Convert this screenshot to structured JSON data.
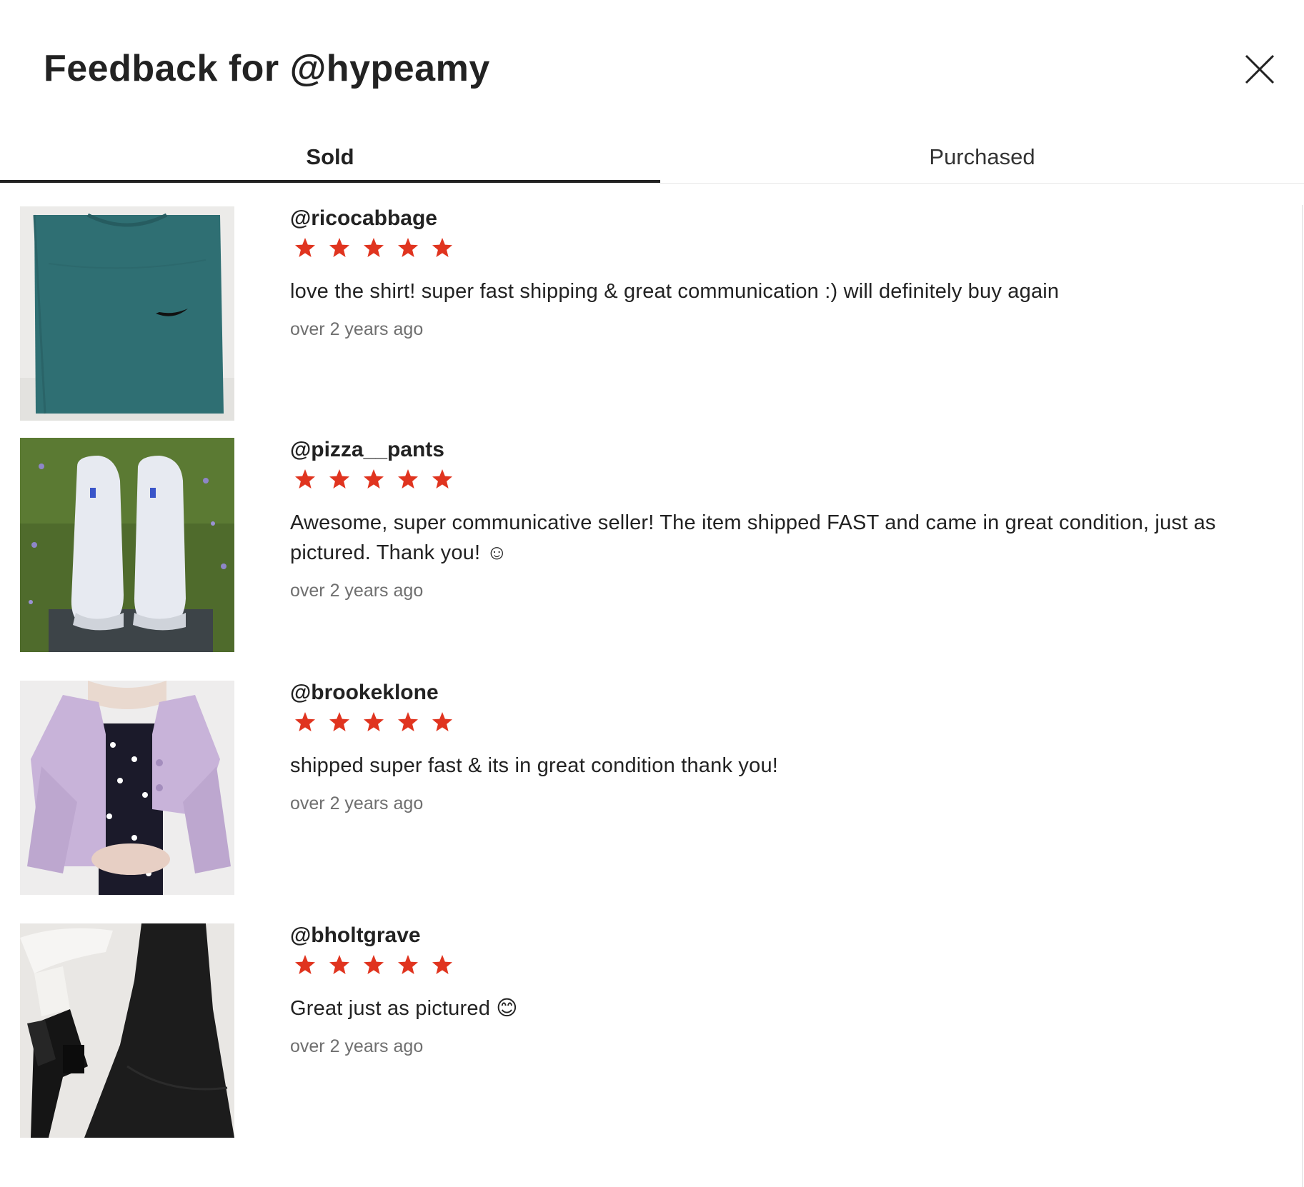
{
  "modal": {
    "title": "Feedback for @hypeamy"
  },
  "tabs": [
    {
      "label": "Sold",
      "active": true
    },
    {
      "label": "Purchased",
      "active": false
    }
  ],
  "colors": {
    "star": "#e0341f",
    "text": "#222222",
    "muted": "#6f6f6f"
  },
  "reviews": [
    {
      "user": "@ricocabbage",
      "rating": 5,
      "comment": "love the shirt! super fast shipping & great communication :) will definitely buy again",
      "time": "over 2 years ago",
      "image": "teal-nike-tshirt"
    },
    {
      "user": "@pizza__pants",
      "rating": 5,
      "comment": "Awesome, super communicative seller! The item shipped FAST and came in great condition, just as pictured. Thank you! ☺",
      "time": "over 2 years ago",
      "image": "white-sneakers-on-grass"
    },
    {
      "user": "@brookeklone",
      "rating": 5,
      "comment": "shipped super fast & its in great condition thank you!",
      "time": "over 2 years ago",
      "image": "lilac-cropped-jacket"
    },
    {
      "user": "@bholtgrave",
      "rating": 5,
      "comment": "Great just as pictured 😊",
      "time": "over 2 years ago",
      "image": "black-dress-and-boots"
    }
  ]
}
